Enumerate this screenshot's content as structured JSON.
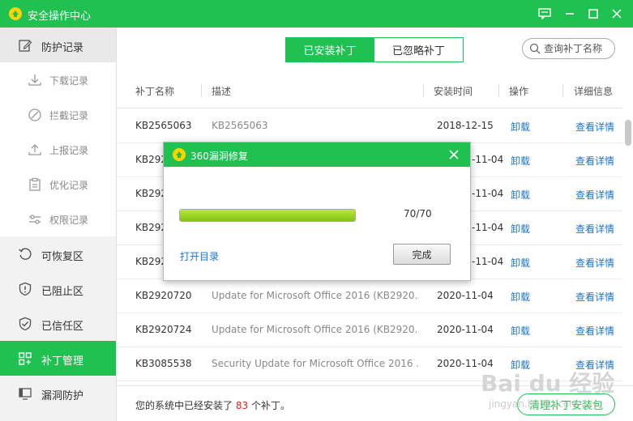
{
  "window": {
    "title": "安全操作中心"
  },
  "sidebar": {
    "items": [
      {
        "label": "防护记录",
        "icon": "edit-icon"
      },
      {
        "label": "下载记录",
        "icon": "download-icon"
      },
      {
        "label": "拦截记录",
        "icon": "block-icon"
      },
      {
        "label": "上报记录",
        "icon": "upload-icon"
      },
      {
        "label": "优化记录",
        "icon": "clipboard-icon"
      },
      {
        "label": "权限记录",
        "icon": "sliders-icon"
      },
      {
        "label": "可恢复区",
        "icon": "restore-icon"
      },
      {
        "label": "已阻止区",
        "icon": "shield-warning-icon"
      },
      {
        "label": "已信任区",
        "icon": "shield-check-icon"
      },
      {
        "label": "补丁管理",
        "icon": "grid-icon"
      },
      {
        "label": "漏洞防护",
        "icon": "monitor-icon"
      }
    ]
  },
  "tabs": [
    {
      "label": "已安装补丁"
    },
    {
      "label": "已忽略补丁"
    }
  ],
  "search": {
    "placeholder": "查询补丁名称"
  },
  "table": {
    "headers": [
      "补丁名称",
      "描述",
      "安装时间",
      "操作",
      "详细信息"
    ],
    "rows": [
      {
        "name": "KB2565063",
        "desc": "KB2565063",
        "date": "2018-12-15",
        "op": "卸载",
        "detail": "查看详情"
      },
      {
        "name": "KB292",
        "desc": "",
        "date": "-11-04",
        "op": "卸载",
        "detail": "查看详情"
      },
      {
        "name": "KB292",
        "desc": "",
        "date": "-11-04",
        "op": "卸载",
        "detail": "查看详情"
      },
      {
        "name": "KB292",
        "desc": "",
        "date": "-11-04",
        "op": "卸载",
        "detail": "查看详情"
      },
      {
        "name": "KB292",
        "desc": "",
        "date": "-11-04",
        "op": "卸载",
        "detail": "查看详情"
      },
      {
        "name": "KB2920720",
        "desc": "Update for Microsoft Office 2016 (KB2920...",
        "date": "2020-11-04",
        "op": "卸载",
        "detail": "查看详情"
      },
      {
        "name": "KB2920724",
        "desc": "Update for Microsoft Office 2016 (KB2920...",
        "date": "2020-11-04",
        "op": "卸载",
        "detail": "查看详情"
      },
      {
        "name": "KB3085538",
        "desc": "Security Update for Microsoft Office 2016 ...",
        "date": "2020-11-04",
        "op": "卸载",
        "detail": "查看详情"
      }
    ]
  },
  "footer": {
    "prefix": "您的系统中已经安装了",
    "count": "83",
    "suffix": "个补丁。",
    "clean_label": "清理补丁安装包"
  },
  "dialog": {
    "title": "360漏洞修复",
    "progress_fraction": 1.0,
    "progress_text": "70/70",
    "open_dir_label": "打开目录",
    "done_label": "完成"
  },
  "watermark": {
    "text": "Bai du 经验",
    "sub": "jingyan.baidu.com"
  },
  "colors": {
    "accent": "#1fc250",
    "link": "#1a73c9",
    "count": "#e02020"
  }
}
